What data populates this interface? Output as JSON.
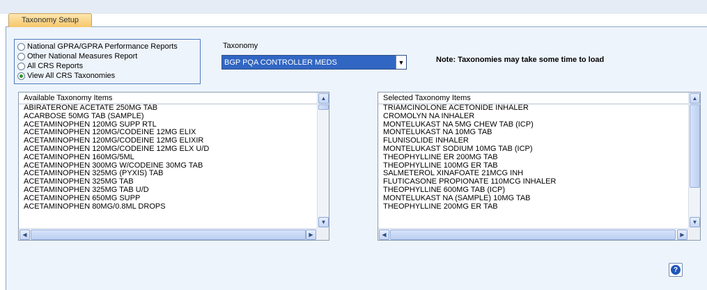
{
  "tab": {
    "label": "Taxonomy Setup"
  },
  "report_types": [
    {
      "label": "National GPRA/GPRA Performance Reports",
      "checked": false
    },
    {
      "label": "Other National Measures Report",
      "checked": false
    },
    {
      "label": "All CRS Reports",
      "checked": false
    },
    {
      "label": "View All CRS Taxonomies",
      "checked": true
    }
  ],
  "taxonomy": {
    "label": "Taxonomy",
    "selected": "BGP PQA CONTROLLER MEDS"
  },
  "note": "Note:  Taxonomies may take some time to load",
  "available": {
    "header": "Available Taxonomy Items",
    "items": [
      "ABIRATERONE ACETATE 250MG TAB",
      "ACARBOSE 50MG TAB (SAMPLE)",
      "ACETAMINOPHEN 120MG SUPP RTL",
      "ACETAMINOPHEN 120MG/CODEINE 12MG  ELIX",
      "ACETAMINOPHEN 120MG/CODEINE 12MG ELIXIR",
      "ACETAMINOPHEN 120MG/CODEINE 12MG ELX U/D",
      "ACETAMINOPHEN 160MG/5ML",
      "ACETAMINOPHEN 300MG W/CODEINE 30MG TAB",
      "ACETAMINOPHEN 325MG (PYXIS) TAB",
      "ACETAMINOPHEN 325MG TAB",
      "ACETAMINOPHEN 325MG TAB U/D",
      "ACETAMINOPHEN 650MG SUPP",
      "ACETAMINOPHEN 80MG/0.8ML DROPS"
    ]
  },
  "selected_list": {
    "header": "Selected Taxonomy Items",
    "items": [
      "TRIAMCINOLONE ACETONIDE INHALER",
      "CROMOLYN NA INHALER",
      "MONTELUKAST NA 5MG CHEW TAB (ICP)",
      "MONTELUKAST NA 10MG TAB",
      "FLUNISOLIDE INHALER",
      "MONTELUKAST SODIUM 10MG TAB (ICP)",
      "THEOPHYLLINE ER 200MG TAB",
      "THEOPHYLLINE 100MG ER TAB",
      "SALMETEROL XINAFOATE 21MCG INH",
      "FLUTICASONE PROPIONATE 110MCG INHALER",
      "THEOPHYLLINE 600MG TAB (ICP)",
      "MONTELUKAST NA (SAMPLE) 10MG TAB",
      "THEOPHYLLINE 200MG ER TAB"
    ]
  },
  "help": {
    "glyph": "?"
  },
  "icons": {
    "scroll_up": "up-arrow-icon",
    "scroll_down": "down-arrow-icon",
    "scroll_left": "left-arrow-icon",
    "scroll_right": "right-arrow-icon",
    "dropdown": "dropdown-arrow-icon",
    "help": "help-icon"
  },
  "colors": {
    "accent": "#3166c3",
    "panel": "#eef4fb",
    "radio_checked": "#2a9a2a"
  }
}
